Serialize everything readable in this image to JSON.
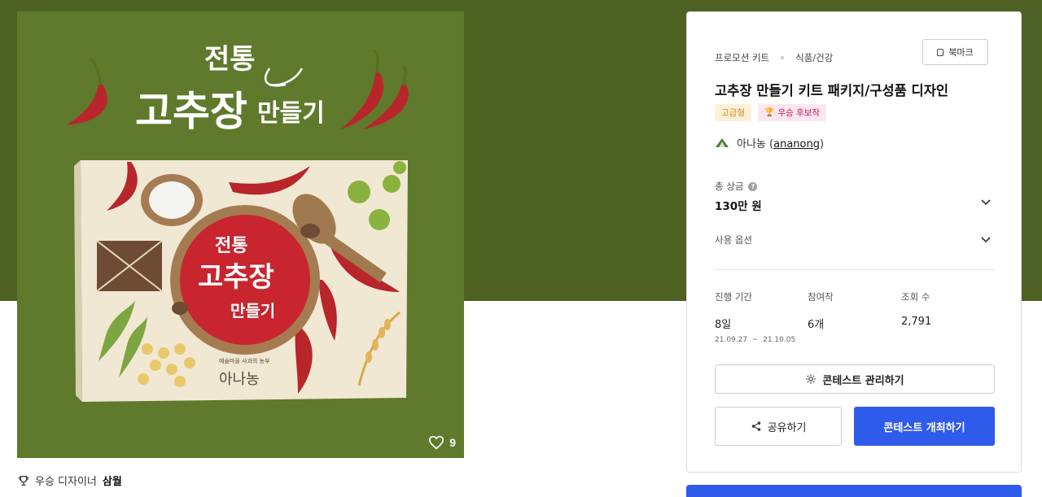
{
  "product": {
    "image_alt": "전통 고추장 만들기",
    "headline_top": "전통",
    "headline_main": "고추장",
    "headline_sub": "만들기",
    "box_small_text": "예술마을 사과의 농부",
    "box_brand": "아나농",
    "likes": "9",
    "colors": {
      "background": "#5f7a2c",
      "hero": "#4d6122",
      "chili": "#b8252a"
    }
  },
  "winner": {
    "prefix": "우승 디자이너",
    "name": "삼월"
  },
  "side": {
    "breadcrumb": [
      "프로모션 키트",
      "식품/건강"
    ],
    "bookmark_label": "북마크",
    "title": "고추장 만들기 키트 패키지/구성품 디자인",
    "badges": {
      "premium": "고급형",
      "candidate": "우승 후보작"
    },
    "organizer": {
      "name": "아나농",
      "handle_open": "(",
      "handle": "ananong",
      "handle_close": ")"
    },
    "prize": {
      "label": "총 상금",
      "value": "130만 원"
    },
    "usage_label": "사용 옵션",
    "stats": {
      "period": {
        "label": "진행 기간",
        "value": "8일",
        "start": "21.09.27",
        "sep": "~",
        "end": "21.10.05"
      },
      "participants": {
        "label": "참여작",
        "value": "6개"
      },
      "views": {
        "label": "조회 수",
        "value": "2,791"
      }
    },
    "buttons": {
      "manage": "콘테스트 관리하기",
      "share": "공유하기",
      "host": "콘테스트 개최하기"
    },
    "accent_color": "#2f5bea"
  }
}
